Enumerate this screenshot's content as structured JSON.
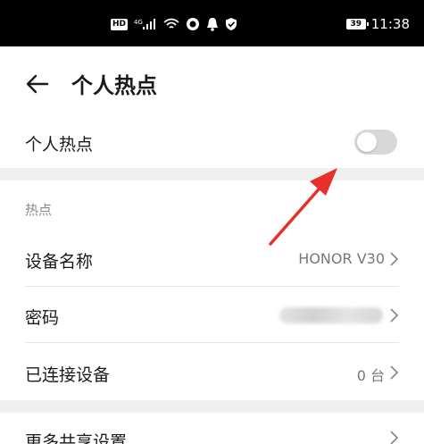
{
  "status_bar": {
    "hd_badge": "HD",
    "signal_label": "4G",
    "icons": [
      "hd-icon",
      "signal-icon",
      "wifi-icon",
      "app-icon",
      "notification-bell-icon",
      "shield-check-icon"
    ],
    "battery": "39",
    "time": "11:38"
  },
  "header": {
    "back_icon": "arrow-left-icon",
    "title": "个人热点"
  },
  "hotspot_toggle": {
    "label": "个人热点",
    "enabled": false
  },
  "section": {
    "header": "热点",
    "rows": [
      {
        "label": "设备名称",
        "value": "HONOR V30"
      },
      {
        "label": "密码",
        "value": ""
      },
      {
        "label": "已连接设备",
        "value": "0 台"
      }
    ]
  },
  "more": {
    "label": "更多共享设置"
  },
  "colors": {
    "annotation_arrow": "#e8302a",
    "toggle_off": "#d8d8d8"
  }
}
